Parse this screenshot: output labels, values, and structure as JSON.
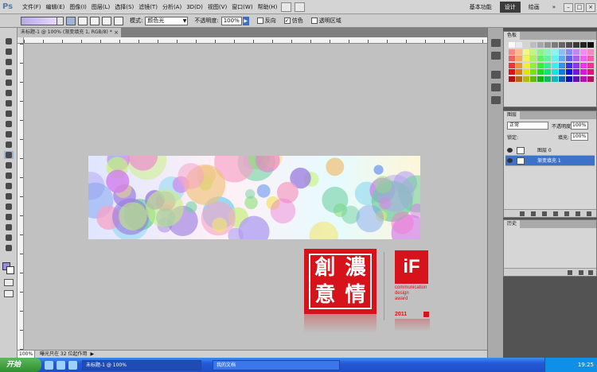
{
  "app": {
    "logo": "Ps"
  },
  "menu": [
    "文件(F)",
    "编辑(E)",
    "图像(I)",
    "图层(L)",
    "选择(S)",
    "滤镜(T)",
    "分析(A)",
    "3D(D)",
    "视图(V)",
    "窗口(W)",
    "帮助(H)"
  ],
  "workspace": {
    "basic": "基本功能",
    "design": "设计",
    "paint": "绘画",
    "more": "»"
  },
  "options": {
    "mode_label": "模式:",
    "mode_value": "颜色光",
    "opacity_label": "不透明度:",
    "opacity_value": "100%",
    "reverse_label": "反向",
    "dither_label": "仿色",
    "transparency_label": "透明区域"
  },
  "document": {
    "tab_title": "未标题-1 @ 100% (渐变填充 1, RGB/8) *",
    "zoom": "100%",
    "doc_info": "曝光只在 32 位起作用"
  },
  "artwork": {
    "seal_chars": [
      "創",
      "意",
      "濃",
      "情"
    ],
    "if_logo": "iF",
    "if_text": [
      "communication",
      "design",
      "award"
    ],
    "if_year": "2011"
  },
  "panels": {
    "swatches_tabs": [
      "色板"
    ],
    "layers_tabs": [
      "图层"
    ],
    "blend_mode": "正常",
    "opacity_label": "不透明度:",
    "opacity_value": "100%",
    "lock_label": "锁定:",
    "fill_label": "填充:",
    "fill_value": "100%",
    "layers": [
      {
        "name": "图层 0",
        "selected": false
      },
      {
        "name": "渐变填充 1",
        "selected": true
      }
    ],
    "history_tabs": [
      "历史"
    ]
  },
  "taskbar": {
    "start": "开始",
    "tasks": [
      "未标题-1 @ 100%",
      "我的文档"
    ],
    "clock": "19:25"
  }
}
